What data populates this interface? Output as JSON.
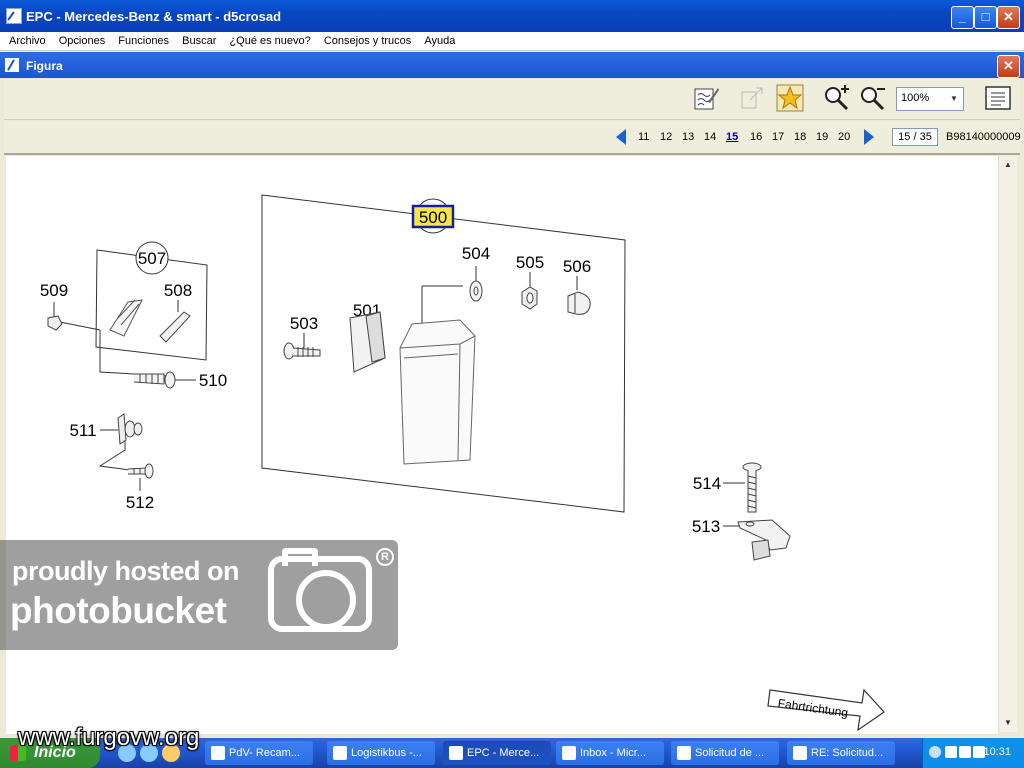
{
  "window": {
    "title": "EPC - Mercedes-Benz & smart - d5crosad"
  },
  "menu": [
    "Archivo",
    "Opciones",
    "Funciones",
    "Buscar",
    "¿Qué es nuevo?",
    "Consejos y trucos",
    "Ayuda"
  ],
  "figure_window": {
    "title": "Figura"
  },
  "toolbar": {
    "zoom_value": "100%"
  },
  "pagination": {
    "pages": [
      "11",
      "12",
      "13",
      "14",
      "15",
      "16",
      "17",
      "18",
      "19",
      "20"
    ],
    "current": "15",
    "page_counter": "15 / 35",
    "figure_id": "B98140000009"
  },
  "diagram": {
    "callouts": {
      "c500": "500",
      "c501": "501",
      "c503": "503",
      "c504": "504",
      "c505": "505",
      "c506": "506",
      "c507": "507",
      "c508": "508",
      "c509": "509",
      "c510": "510",
      "c511": "511",
      "c512": "512",
      "c513": "513",
      "c514": "514"
    },
    "direction_label": "Fahrtrichtung",
    "selected_callout": "500"
  },
  "watermark": {
    "line1": "proudly hosted on",
    "line2": "photobucket",
    "reg": "R"
  },
  "site_watermark": "www.furgovw.org",
  "taskbar": {
    "start": "Inicio",
    "tasks": [
      "PdV- Recam...",
      "Logistikbus -...",
      "EPC - Merce...",
      "Inbox - Micr...",
      "Solicitud de ...",
      "RE: Solicitud..."
    ],
    "active_task": "EPC - Merce...",
    "clock": "10:31"
  }
}
